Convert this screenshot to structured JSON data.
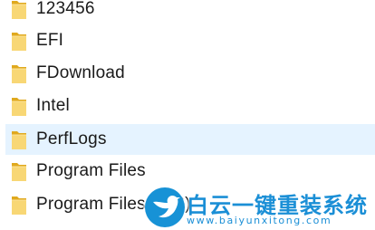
{
  "file_list": {
    "items": [
      {
        "name": "123456",
        "selected": false
      },
      {
        "name": "EFI",
        "selected": false
      },
      {
        "name": "FDownload",
        "selected": false
      },
      {
        "name": "Intel",
        "selected": false
      },
      {
        "name": "PerfLogs",
        "selected": true
      },
      {
        "name": "Program Files",
        "selected": false
      },
      {
        "name": "Program Files (x86)",
        "selected": false
      }
    ],
    "colors": {
      "folder_back": "#e0a91e",
      "folder_front": "#f8d775",
      "selected_background": "#e5f3ff"
    }
  },
  "watermark": {
    "title": "白云一键重装系统",
    "url": "www.baiyunxitong.com",
    "icon": "bird-icon",
    "color": "#1b8fd6"
  }
}
